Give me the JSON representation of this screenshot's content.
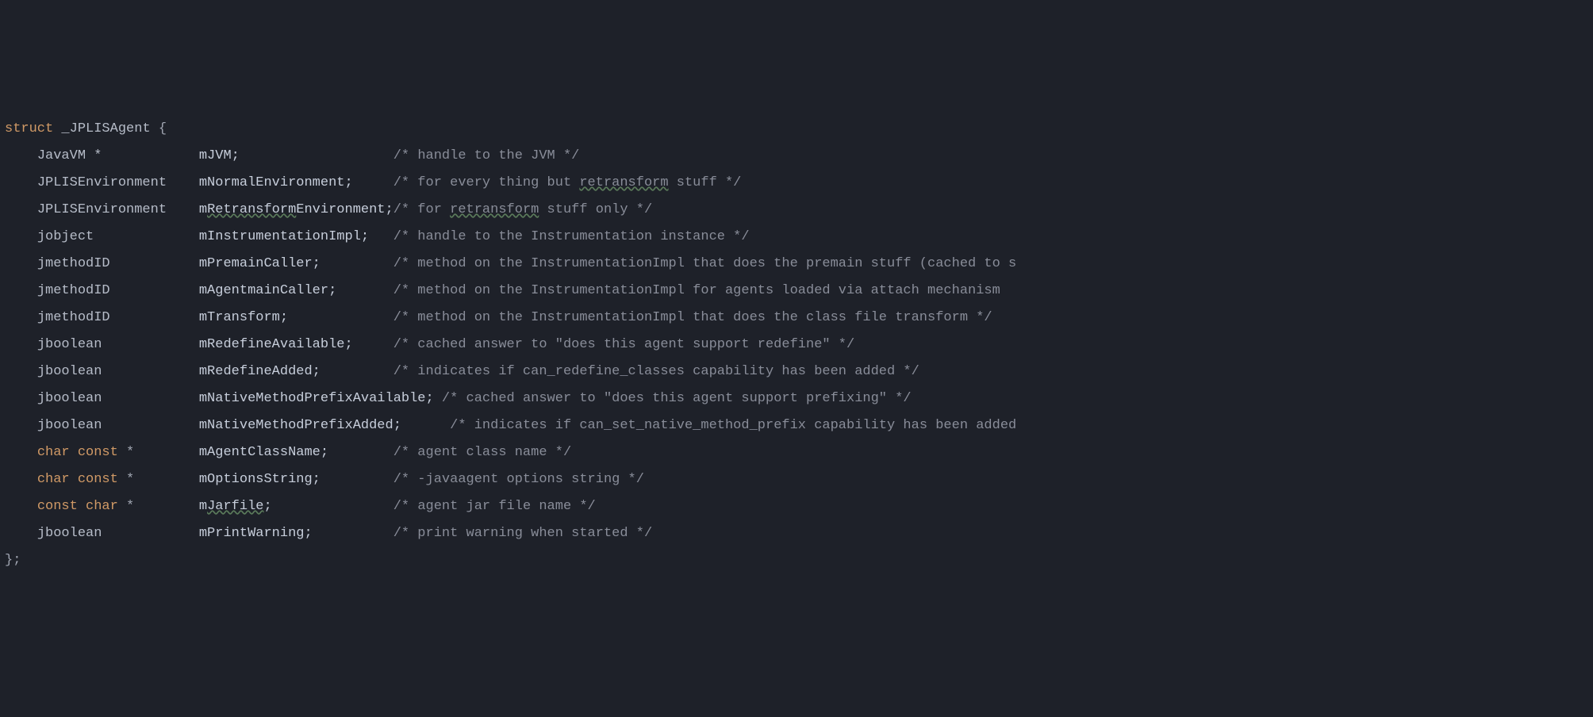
{
  "struct_kw": "struct",
  "struct_name": "_JPLISAgent",
  "open_brace": "{",
  "close_brace": "};",
  "indent": "    ",
  "lines": [
    {
      "type": "JavaVM *            ",
      "mpre": "mJVM",
      "mwarn": "",
      "mpost": ";                   ",
      "comment": "/* handle to the JVM */"
    },
    {
      "type": "JPLISEnvironment    ",
      "mpre": "mNormalEnvironment;     ",
      "mwarn": "",
      "mpost": "",
      "comment": "/* for every thing but ",
      "cwarn": "retransform",
      "cpost": " stuff */"
    },
    {
      "type": "JPLISEnvironment    ",
      "mpre": "m",
      "mwarn": "Retransform",
      "mpost": "Environment;",
      "comment": "/* for ",
      "cwarn": "retransform",
      "cpost": " stuff only */"
    },
    {
      "type": "jobject             ",
      "mpre": "mInstrumentationImpl;   ",
      "mwarn": "",
      "mpost": "",
      "comment": "/* handle to the Instrumentation instance */"
    },
    {
      "type": "jmethodID           ",
      "mpre": "mPremainCaller;         ",
      "mwarn": "",
      "mpost": "",
      "comment": "/* method on the InstrumentationImpl that does the premain stuff (cached to s"
    },
    {
      "type": "jmethodID           ",
      "mpre": "mAgentmainCaller;       ",
      "mwarn": "",
      "mpost": "",
      "comment": "/* method on the InstrumentationImpl for agents loaded via attach mechanism "
    },
    {
      "type": "jmethodID           ",
      "mpre": "mTransform;             ",
      "mwarn": "",
      "mpost": "",
      "comment": "/* method on the InstrumentationImpl that does the class file transform */"
    },
    {
      "type": "jboolean            ",
      "mpre": "mRedefineAvailable;     ",
      "mwarn": "",
      "mpost": "",
      "comment": "/* cached answer to \"does this agent support redefine\" */"
    },
    {
      "type": "jboolean            ",
      "mpre": "mRedefineAdded;         ",
      "mwarn": "",
      "mpost": "",
      "comment": "/* indicates if can_redefine_classes capability has been added */"
    },
    {
      "type": "jboolean            ",
      "mpre": "mNativeMethodPrefixAvailable; ",
      "mwarn": "",
      "mpost": "",
      "comment": "/* cached answer to \"does this agent support prefixing\" */"
    },
    {
      "type": "jboolean            ",
      "mpre": "mNativeMethodPrefixAdded;      ",
      "mwarn": "",
      "mpost": "",
      "comment": "/* indicates if can_set_native_method_prefix capability has been added"
    },
    {
      "type_kw": "char const ",
      "type_punct": "*        ",
      "mpre": "mAgentClassName;        ",
      "mwarn": "",
      "mpost": "",
      "comment": "/* agent class name */"
    },
    {
      "type_kw": "char const ",
      "type_punct": "*        ",
      "mpre": "mOptionsString;         ",
      "mwarn": "",
      "mpost": "",
      "comment": "/* -javaagent options string */"
    },
    {
      "type_kw": "const char ",
      "type_punct": "*        ",
      "mpre": "m",
      "mwarn": "Jarfile",
      "mpost": ";               ",
      "comment": "/* agent jar file name */"
    },
    {
      "type": "jboolean            ",
      "mpre": "mPrintWarning;          ",
      "mwarn": "",
      "mpost": "",
      "comment": "/* print warning when started */"
    }
  ]
}
